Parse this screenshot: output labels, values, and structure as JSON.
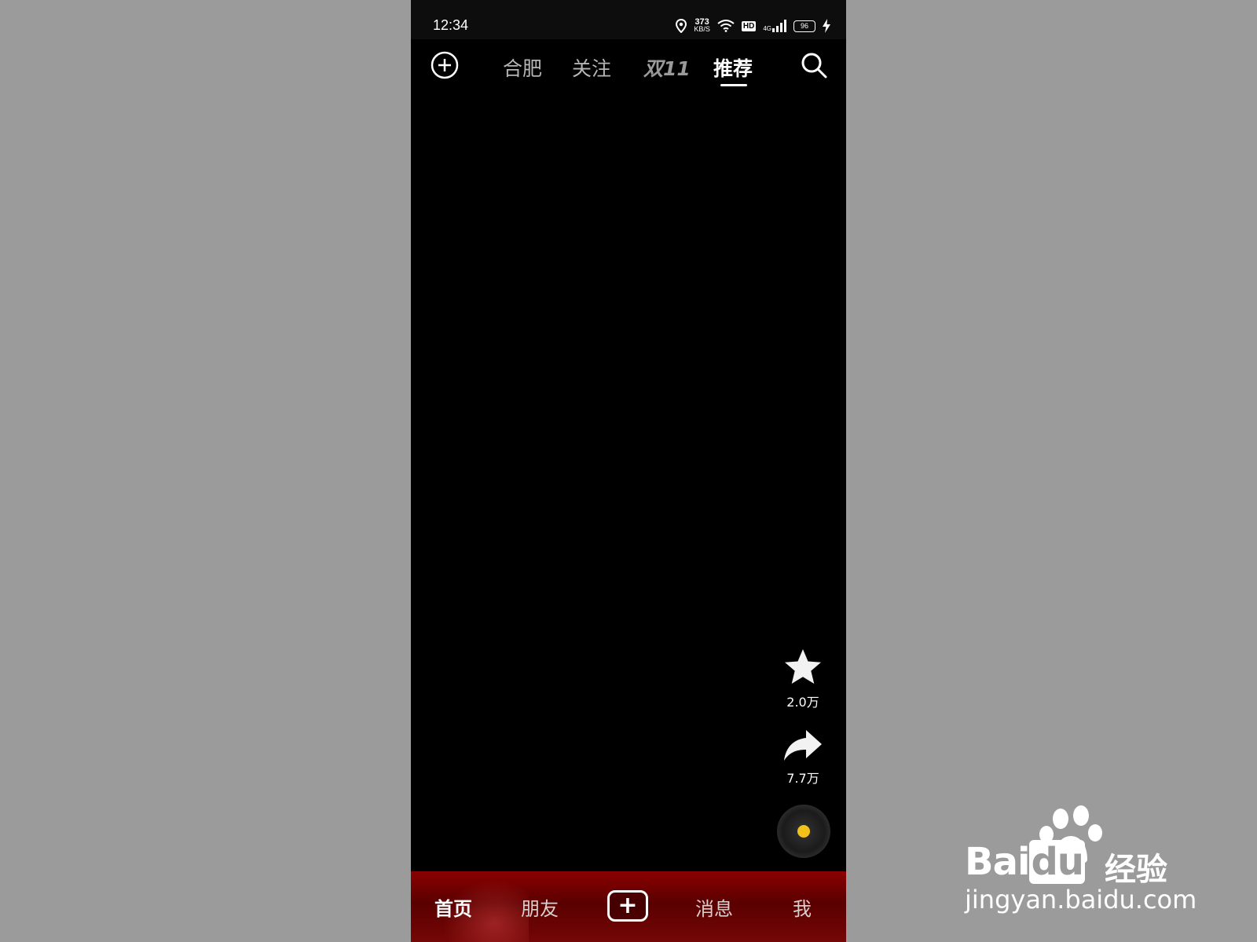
{
  "status_bar": {
    "time": "12:34",
    "net_speed_value": "373",
    "net_speed_unit": "KB/S",
    "hd_label": "HD",
    "signal_label": "4G",
    "battery": "96",
    "icons": [
      "location-icon",
      "wifi-icon",
      "signal-icon",
      "battery-icon",
      "charging-icon"
    ]
  },
  "top_nav": {
    "tabs": [
      {
        "label": "合肥",
        "active": false
      },
      {
        "label": "关注",
        "active": false
      },
      {
        "label": "双11",
        "active": false
      },
      {
        "label": "推荐",
        "active": true
      }
    ],
    "left_icon": "add-circle-icon",
    "right_icon": "search-icon"
  },
  "side_actions": {
    "favorite_count": "2.0万",
    "share_count": "7.7万",
    "music_disc": "music-disc-icon"
  },
  "bottom_nav": {
    "items": [
      {
        "label": "首页",
        "active": true
      },
      {
        "label": "朋友",
        "active": false
      },
      {
        "label": "消息",
        "active": false
      },
      {
        "label": "我",
        "active": false
      }
    ],
    "create_icon": "plus-icon"
  },
  "watermark": {
    "brand": "Bai",
    "brand_du": "du",
    "product": "经验",
    "url": "jingyan.baidu.com"
  },
  "colors": {
    "background": "#9b9b9b",
    "screen": "#000000",
    "bottom_bar": "#7a0303",
    "disc_dot": "#f3c21a"
  }
}
